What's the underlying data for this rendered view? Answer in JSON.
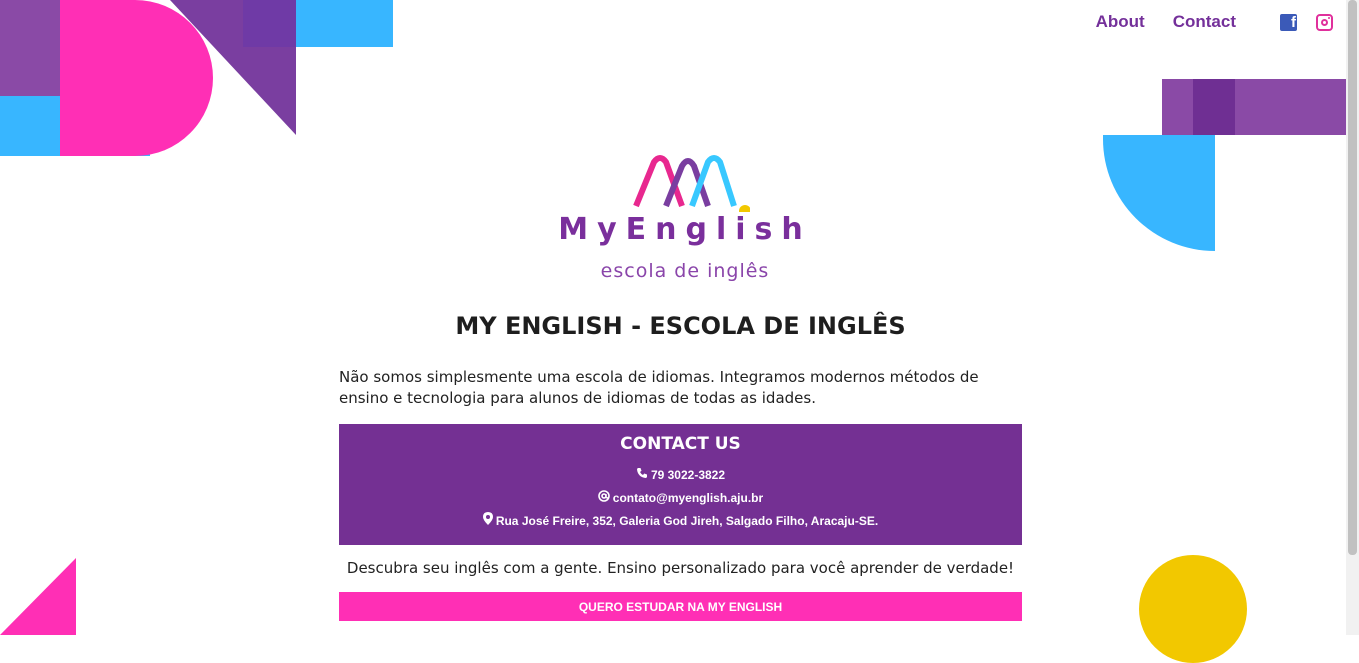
{
  "nav": {
    "about_label": "About",
    "contact_label": "Contact",
    "facebook_icon": "facebook-icon",
    "instagram_icon": "instagram-icon"
  },
  "logo": {
    "name": "MyEnglish",
    "subtitle": "escola de inglês"
  },
  "hero": {
    "title": "MY ENGLISH - ESCOLA DE INGLÊS",
    "intro": "Não somos simplesmente uma escola de idiomas. Integramos modernos métodos de ensino e tecnologia para alunos de idiomas de todas as idades."
  },
  "contact": {
    "heading": "CONTACT US",
    "phone": "79 3022-3822",
    "email": "contato@myenglish.aju.br",
    "address": "Rua José Freire, 352, Galeria God Jireh, Salgado Filho, Aracaju-SE.",
    "phone_icon": "phone-icon",
    "email_icon": "at-icon",
    "address_icon": "map-marker-icon"
  },
  "tagline": "Descubra seu inglês com a gente. Ensino personalizado para você aprender de verdade!",
  "cta_label": "QUERO ESTUDAR NA MY ENGLISH",
  "colors": {
    "primary_purple": "#743093",
    "pink": "#ff2fb5",
    "blue": "#38b6ff",
    "yellow": "#f2c800"
  }
}
